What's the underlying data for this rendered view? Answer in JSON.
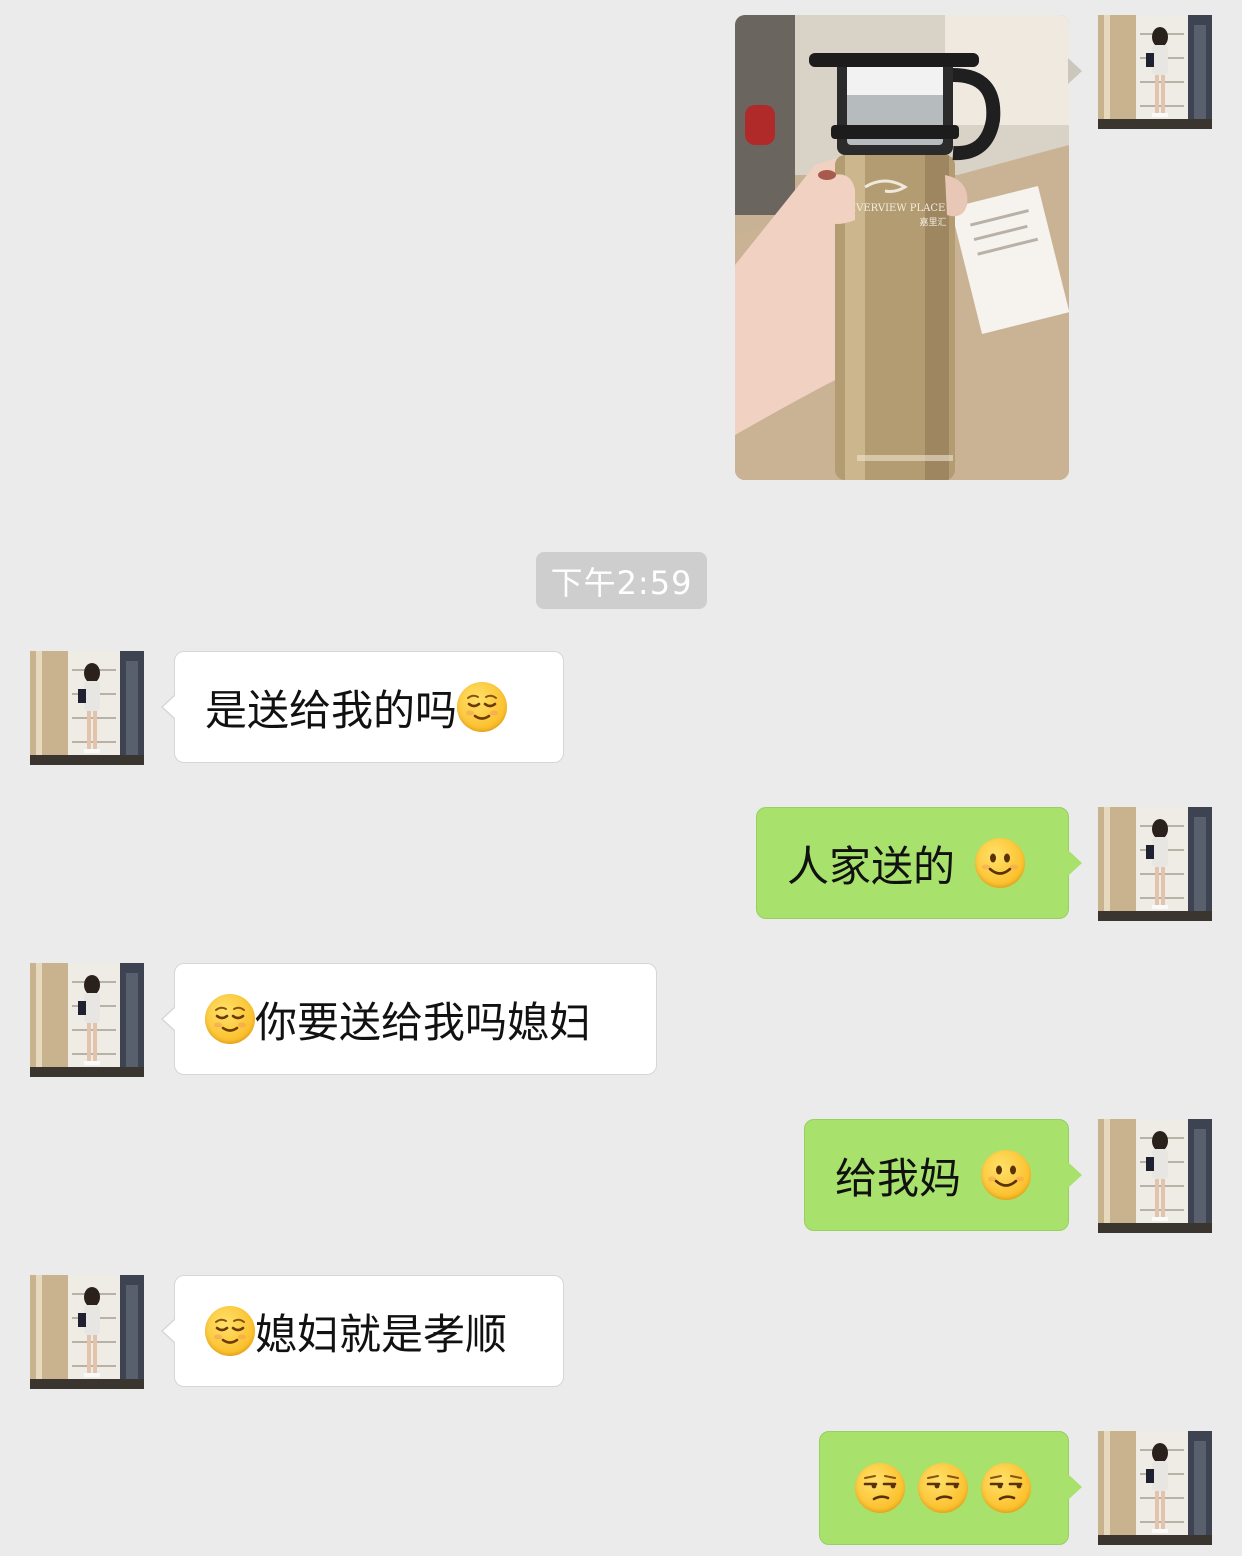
{
  "chat": {
    "timestamp": "下午2:59",
    "photo": {
      "bottle_brand": "RIVERVIEW PLACE",
      "bottle_brand_cn": "嘉里汇"
    },
    "messages": [
      {
        "side": "incoming",
        "text": "是送给我的吗",
        "emoji": "relieved-face"
      },
      {
        "side": "outgoing",
        "text": "人家送的",
        "emoji": "smiling-face"
      },
      {
        "side": "incoming",
        "text": "你要送给我吗媳妇",
        "emoji": "relieved-face"
      },
      {
        "side": "outgoing",
        "text": "给我妈",
        "emoji": "smiling-face"
      },
      {
        "side": "incoming",
        "text": "媳妇就是孝顺",
        "emoji": "relieved-face"
      },
      {
        "side": "outgoing",
        "text": "",
        "emoji": "unamused-face x3"
      }
    ]
  },
  "colors": {
    "background": "#ebebeb",
    "incoming_bubble": "#ffffff",
    "outgoing_bubble": "#a8e26c",
    "timestamp_pill": "#cecece"
  }
}
